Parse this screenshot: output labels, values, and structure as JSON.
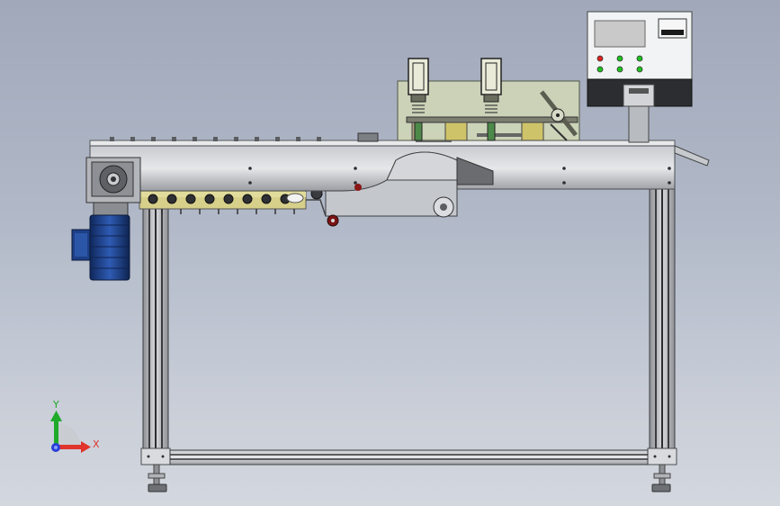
{
  "view": {
    "background_top": "#a0a8ba",
    "background_bottom": "#d3d7de"
  },
  "triad": {
    "x_label": "X",
    "y_label": "Y",
    "x_color": "#e0342c",
    "y_color": "#1faa2a",
    "z_color": "#2a3fd8"
  },
  "control_panel": {
    "screen_color": "#c9c9c9",
    "display_color": "#1a1a1a",
    "indicator_colors": [
      "#e02020",
      "#1ec21e",
      "#1ec21e",
      "#1ec21e",
      "#1ec21e",
      "#1ec21e"
    ]
  },
  "materials": {
    "frame_color": "#bfc2c7",
    "profile_color": "#6d6f73",
    "motor_color": "#1d3f86",
    "guard_color": "#d1d8b6",
    "roller_color": "#cfc36a"
  }
}
